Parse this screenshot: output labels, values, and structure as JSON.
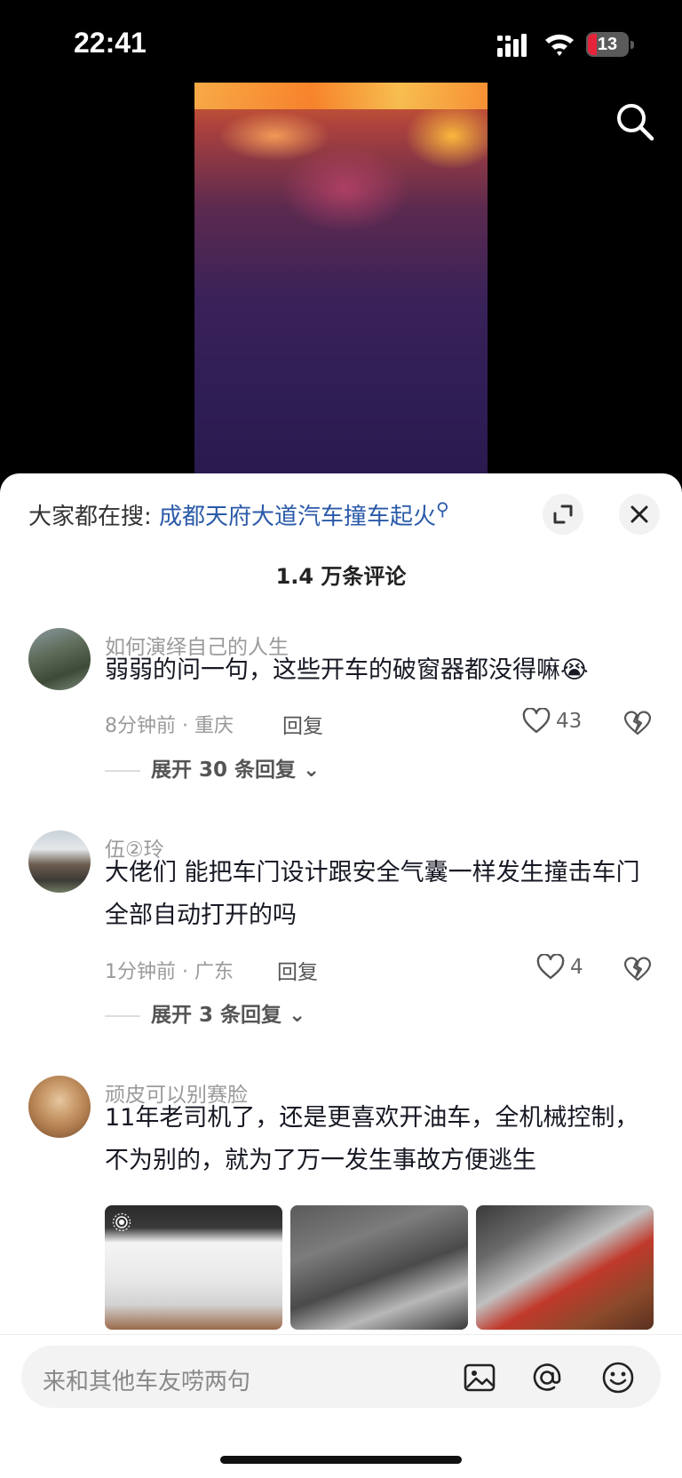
{
  "status_bar": {
    "time": "22:41",
    "battery": "13"
  },
  "sheet": {
    "hot_search_prefix": "大家都在搜:",
    "hot_search_term": "成都天府大道汽车撞车起火",
    "comment_count": "1.4 万条评论"
  },
  "comments": [
    {
      "user": "如何演绎自己的人生",
      "text": "弱弱的问一句，这些开车的破窗器都没得嘛😭",
      "meta": "8分钟前 · 重庆",
      "reply_label": "回复",
      "likes": "43",
      "expand_label": "展开 30 条回复"
    },
    {
      "user": "伍②玲",
      "text": "大佬们 能把车门设计跟安全气囊一样发生撞击车门全部自动打开的吗",
      "meta": "1分钟前 · 广东",
      "reply_label": "回复",
      "likes": "4",
      "expand_label": "展开 3 条回复"
    },
    {
      "user": "顽皮可以别赛脸",
      "text": "11年老司机了，还是更喜欢开油车，全机械控制，不为别的，就为了万一发生事故方便逃生"
    }
  ],
  "composer": {
    "placeholder": "来和其他车友唠两句"
  },
  "colors": {
    "link": "#2a5aa8",
    "battery_low": "#e5243b"
  }
}
